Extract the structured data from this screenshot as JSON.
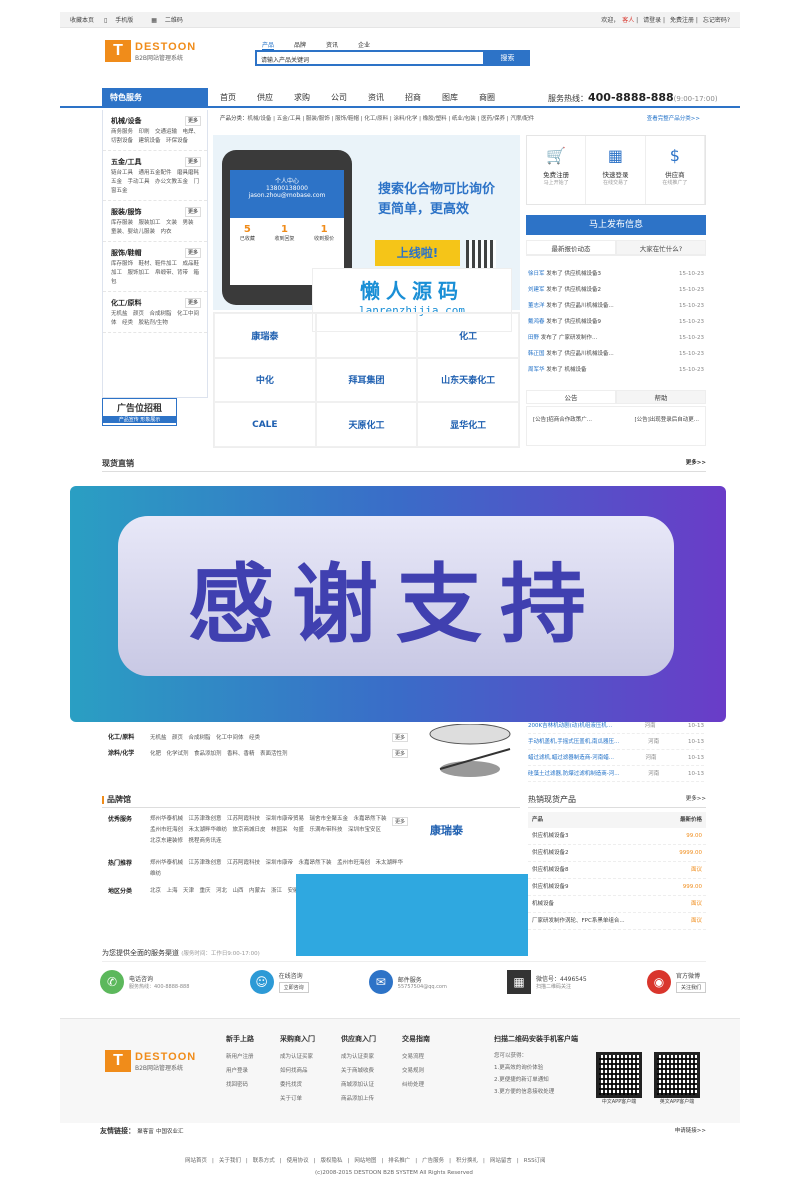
{
  "topbar": {
    "left": [
      "收藏本页",
      "手机版",
      "二维码"
    ],
    "welcome": "欢迎，",
    "guest": "客人",
    "login": "请登录",
    "register": "免费注册",
    "forgot": "忘记密码?"
  },
  "logo": {
    "mark": "T",
    "brand": "DESTOON",
    "sub": "B2B网站管理系统"
  },
  "search": {
    "tabs": [
      "产品",
      "品牌",
      "资讯",
      "企业"
    ],
    "placeholder": "请输入产品关键词",
    "button": "搜索"
  },
  "nav": {
    "featured": "特色服务",
    "items": [
      "首页",
      "供应",
      "求购",
      "公司",
      "资讯",
      "招商",
      "图库",
      "商圈"
    ],
    "hotline_label": "服务热线：",
    "hotline": "400-8888-888",
    "hours": "(9:00-17:00)"
  },
  "sidebar": [
    {
      "title": "机械/设备",
      "more": "更多",
      "text": "商务服务　印刷　交通运输　电焊、切割设备　建筑设备　环保设备"
    },
    {
      "title": "五金/工具",
      "more": "更多",
      "text": "链台工具　通用五金配件　磨具磨耗五金　手动工具　办公文教五金　门窗五金"
    },
    {
      "title": "服装/服饰",
      "more": "更多",
      "text": "库存服装　服装加工　文装　男装　童装、婴幼儿服装　内衣"
    },
    {
      "title": "服饰/鞋帽",
      "more": "更多",
      "text": "库存服饰　鞋材、鞋件加工　成品鞋加工　服饰加工　帛缎带、背带　箱包"
    },
    {
      "title": "化工/原料",
      "more": "更多",
      "text": "无机盐　颜页　合成树脂　化工中间体　经类　胶粘剂/生物"
    }
  ],
  "ad": {
    "title": "广告位招租",
    "sub": "产品宣传 形象展示"
  },
  "categories": {
    "label": "产品分类：",
    "items": "机械/设备 | 五金/工具 | 服装/服饰 | 服饰/鞋帽 | 化工/原料 | 涂料/化学 | 橡胶/塑料 | 纸业/包装 | 医药/保养 | 汽摩/配件",
    "more": "查看完整产品分类>>"
  },
  "banner": {
    "line1": "搜索化合物可比询价",
    "line2": "更简单，更高效",
    "online": "上线啦!",
    "phone_title": "个人中心",
    "phone_id": "13800138000",
    "phone_mail": "jason.zhou@mobase.com",
    "nums": [
      {
        "n": "5",
        "l": "已收藏"
      },
      {
        "n": "1",
        "l": "收到回复"
      },
      {
        "n": "1",
        "l": "收到报价"
      }
    ]
  },
  "watermark": {
    "cn": "懒人源码",
    "url": "lanrenzhijia.com"
  },
  "brands": [
    "康瑞泰",
    "",
    "化工",
    "中化",
    "拜耳集团",
    "山东天泰化工",
    "CALE",
    "天原化工",
    "显华化工"
  ],
  "quick": [
    {
      "label": "免费注册",
      "sub": "马上开始了",
      "icon": "🛒"
    },
    {
      "label": "快速登录",
      "sub": "在线交易了",
      "icon": "▦"
    },
    {
      "label": "供应商",
      "sub": "在线推广了",
      "icon": "$"
    }
  ],
  "publish": "马上发布信息",
  "tabs": {
    "a": "最新报价动态",
    "b": "大家在忙什么?"
  },
  "news": [
    {
      "u": "徐日军",
      "t": "发布了 供应机械设备3",
      "d": "15-10-23"
    },
    {
      "u": "刘建军",
      "t": "发布了 供应机械设备2",
      "d": "15-10-23"
    },
    {
      "u": "董志洋",
      "t": "发布了 供应晶川机械设备...",
      "d": "15-10-23"
    },
    {
      "u": "戴鸿春",
      "t": "发布了 供应机械设备9",
      "d": "15-10-23"
    },
    {
      "u": "田野",
      "t": "发布了 广家研发制作...",
      "d": "15-10-23"
    },
    {
      "u": "韩正国",
      "t": "发布了 供应晶川机械设备...",
      "d": "15-10-23"
    },
    {
      "u": "周军华",
      "t": "发布了 机械设备",
      "d": "15-10-23"
    }
  ],
  "notice_tabs": [
    "公告",
    "帮助"
  ],
  "notice": [
    "[公告]招商合作政策广...",
    "[公告]出现登录后自动更..."
  ],
  "spot": {
    "title": "现货直销",
    "more": "更多>>"
  },
  "overlay": "感谢支持",
  "mid_rows": [
    {
      "t": "化工/原料",
      "s": "无机盐　颜页　合成树脂　化工中间体　经类",
      "m": "更多"
    },
    {
      "t": "涂料/化学",
      "s": "化肥　化学试剂　食品添加剂　香料、香精　表面活性剂",
      "m": "更多"
    }
  ],
  "eq": [
    {
      "t": "200K吉林机动剧(动)机组液压机...",
      "a": "河南",
      "d": "10-13"
    },
    {
      "t": "手动机盖机,手摇式压盖机,南瓜器压...",
      "a": "河南",
      "d": "10-13"
    },
    {
      "t": "蜡过滤机,蜡过滤器制造商-河南蜡...",
      "a": "河南",
      "d": "10-13"
    },
    {
      "t": "硅藻土过滤器,防爆过滤机制造商-河...",
      "a": "河南",
      "d": "10-13"
    }
  ],
  "brandhall": {
    "title": "品牌馆",
    "rows": [
      {
        "t": "优秀服务",
        "s": "郑州华泰机械　江苏津珠创意　江苏阿霞科技　深圳市康帝贸易　瑞舍市全聚五金　永嘉昂然下装　孟州市旺海创　禾太湖畔华维纺　旅京商城日皮　林园采　勾盛　乐满布带科技　深圳市宝安区　北京东建装修　携程商务讯连",
        "m": "更多"
      },
      {
        "t": "热门推荐",
        "s": "郑州华泰机械　江苏津珠创意　江苏阿霞科技　深圳市康帝　永嘉昂然下装　孟州市旺海创　禾太湖畔华维纺",
        "m": ""
      },
      {
        "t": "地区分类",
        "s": "北京　上海　天津　重庆　河北　山西　内蒙古　浙江　安徽　福建　江西　山东　河南　湖北　湖南",
        "m": ""
      }
    ],
    "brandname": "康瑞泰"
  },
  "hotp": {
    "title": "热销现货产品",
    "more": "更多>>",
    "col1": "产品",
    "col2": "最新价格",
    "items": [
      {
        "n": "供应机械设备3",
        "p": "99.00"
      },
      {
        "n": "供应机械设备2",
        "p": "9999.00"
      },
      {
        "n": "供应机械设备8",
        "p": "面议"
      },
      {
        "n": "供应机械设备9",
        "p": "999.00"
      },
      {
        "n": "机械设备",
        "p": "面议"
      },
      {
        "n": "厂家研发制作涡轮、FPC系黑单组合...",
        "p": "面议"
      }
    ]
  },
  "service": {
    "title": "为您提供全面的服务渠道",
    "hours": "(服务时间：工作日9:00-17:00)",
    "items": [
      {
        "name": "电话咨询",
        "sub": "服务热线：400-8888-888",
        "btn": "",
        "icon": "✆",
        "color": "#5cb85c"
      },
      {
        "name": "在线咨询",
        "sub": "",
        "btn": "立即咨询",
        "icon": "☺",
        "color": "#2d9ad6"
      },
      {
        "name": "邮件服务",
        "sub": "55757504@qq.com",
        "btn": "",
        "icon": "✉",
        "color": "#2d73c7"
      },
      {
        "name": "微信号：4496545",
        "sub": "扫描二维码关注",
        "btn": "",
        "icon": "▦",
        "color": "#333"
      },
      {
        "name": "官方微博",
        "sub": "",
        "btn": "关注我们",
        "icon": "◉",
        "color": "#d9352c"
      }
    ]
  },
  "footer": {
    "cols": [
      {
        "h": "新手上路",
        "items": [
          "新用户注册",
          "用户登录",
          "找回密码"
        ]
      },
      {
        "h": "采购商入门",
        "items": [
          "成为认证买家",
          "如何找商品",
          "委托找货",
          "关于订单"
        ]
      },
      {
        "h": "供应商入门",
        "items": [
          "成为认证卖家",
          "关于商城收费",
          "商城添加认证",
          "商品添加上传"
        ]
      },
      {
        "h": "交易指南",
        "items": [
          "交易流程",
          "交易规则",
          "纠纷处理"
        ]
      }
    ],
    "app": {
      "h": "扫描二维码安装手机客户端",
      "intro": "您可以获得：",
      "items": [
        "1.更高效的询价体验",
        "2.更便捷的新订单通知",
        "3.更方便的信息接收处理"
      ],
      "qr1": "中文APP客户端",
      "qr2": "英文APP客户端"
    }
  },
  "links": {
    "label": "友情链接：",
    "items": [
      "聚客富",
      "中国农业汇"
    ],
    "apply": "申请链接>>"
  },
  "bottom": [
    "网站首页",
    "关于我们",
    "联系方式",
    "使用协议",
    "版权隐私",
    "网站地图",
    "排名推广",
    "广告服务",
    "积分换礼",
    "网站留言",
    "RSS订阅"
  ],
  "copyright": "(c)2008-2015 DESTOON B2B SYSTEM All Rights Reserved"
}
